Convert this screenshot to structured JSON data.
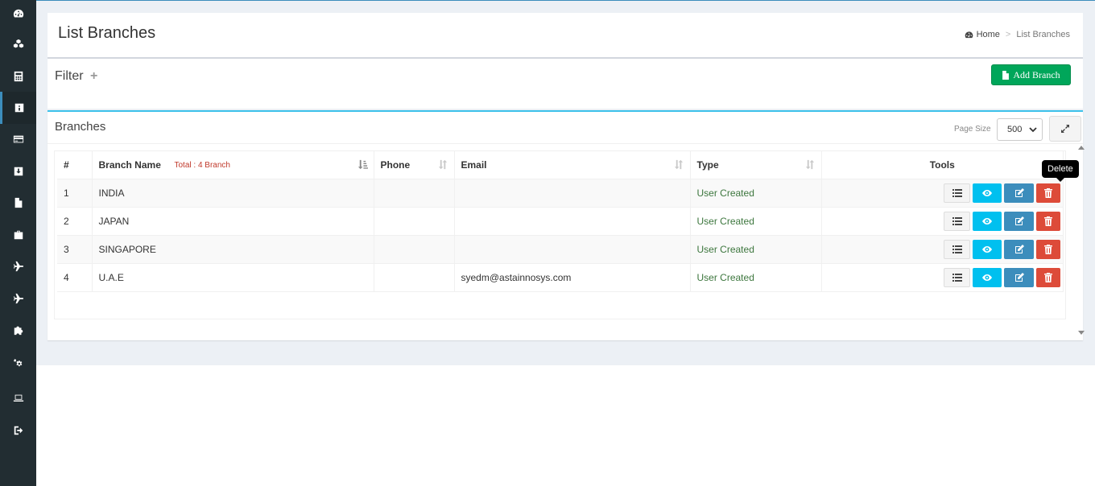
{
  "sidebar": {
    "items": [
      {
        "icon": "dashboard-icon"
      },
      {
        "icon": "cubes-icon"
      },
      {
        "icon": "calculator-icon"
      },
      {
        "icon": "info-icon",
        "active": true
      },
      {
        "icon": "credit-card-icon"
      },
      {
        "icon": "download-icon"
      },
      {
        "icon": "file-icon"
      },
      {
        "icon": "briefcase-icon"
      },
      {
        "icon": "plane-icon"
      },
      {
        "icon": "plane-icon"
      },
      {
        "icon": "puzzle-icon"
      },
      {
        "icon": "cogs-icon"
      },
      {
        "icon": "laptop-icon"
      },
      {
        "icon": "sign-out-icon"
      }
    ]
  },
  "header": {
    "title": "List Branches",
    "breadcrumb": {
      "home": "Home",
      "current": "List Branches",
      "separator": ">"
    }
  },
  "filter": {
    "title": "Filter",
    "toggle": "+",
    "add_button": "Add Branch"
  },
  "list": {
    "title": "Branches",
    "page_size_label": "Page Size",
    "page_size_value": "500",
    "columns": {
      "num": "#",
      "name": "Branch Name",
      "total": "Total : 4 Branch",
      "phone": "Phone",
      "email": "Email",
      "type": "Type",
      "tools": "Tools"
    },
    "rows": [
      {
        "num": "1",
        "name": "INDIA",
        "phone": "",
        "email": "",
        "type": "User Created"
      },
      {
        "num": "2",
        "name": "JAPAN",
        "phone": "",
        "email": "",
        "type": "User Created"
      },
      {
        "num": "3",
        "name": "SINGAPORE",
        "phone": "",
        "email": "",
        "type": "User Created"
      },
      {
        "num": "4",
        "name": "U.A.E",
        "phone": "",
        "email": "syedm@astainnosys.com",
        "type": "User Created"
      }
    ],
    "tooltip": "Delete"
  },
  "colors": {
    "sidebar": "#222d32",
    "accent": "#3c8dbc",
    "success": "#00a65a",
    "info": "#00c0ef",
    "danger": "#dd4b39",
    "type_text": "#3c763d"
  }
}
